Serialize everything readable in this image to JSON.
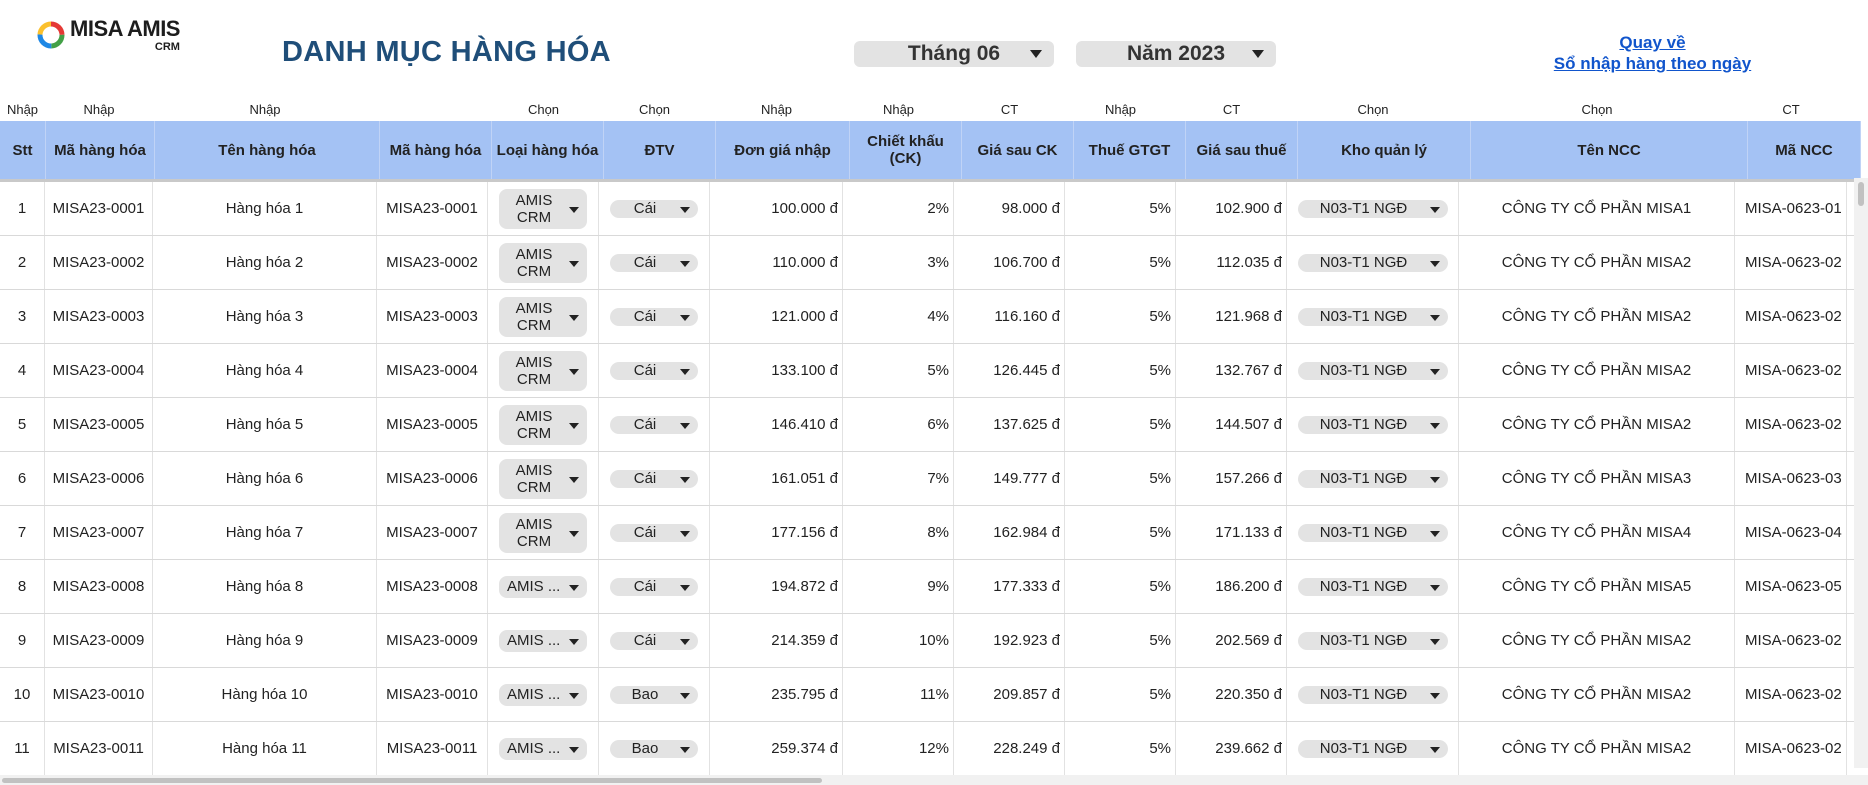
{
  "brand": {
    "name": "MISA AMIS",
    "sub": "CRM"
  },
  "title": "DANH MỤC HÀNG HÓA",
  "month_select": "Tháng 06",
  "year_select": "Năm 2023",
  "back_link": {
    "line1": "Quay về",
    "line2": "Sổ nhập hàng theo ngày"
  },
  "columns": [
    {
      "key": "stt",
      "hint": "Nhập",
      "label": "Stt"
    },
    {
      "key": "ma",
      "hint": "Nhập",
      "label": "Mã hàng hóa"
    },
    {
      "key": "ten",
      "hint": "Nhập",
      "label": "Tên hàng hóa"
    },
    {
      "key": "ma2",
      "hint": "",
      "label": "Mã hàng hóa"
    },
    {
      "key": "loai",
      "hint": "Chọn",
      "label": "Loại hàng hóa"
    },
    {
      "key": "dvt",
      "hint": "Chọn",
      "label": "ĐTV"
    },
    {
      "key": "dongia",
      "hint": "Nhập",
      "label": "Đơn giá nhập"
    },
    {
      "key": "ck",
      "hint": "Nhập",
      "label": "Chiết khấu (CK)"
    },
    {
      "key": "giack",
      "hint": "CT",
      "label": "Giá sau CK"
    },
    {
      "key": "thue",
      "hint": "Nhập",
      "label": "Thuế GTGT"
    },
    {
      "key": "giathue",
      "hint": "CT",
      "label": "Giá sau thuế"
    },
    {
      "key": "kho",
      "hint": "Chọn",
      "label": "Kho quản lý"
    },
    {
      "key": "ncc",
      "hint": "Chọn",
      "label": "Tên NCC"
    },
    {
      "key": "mancc",
      "hint": "CT",
      "label": "Mã NCC"
    }
  ],
  "rows": [
    {
      "stt": "1",
      "ma": "MISA23-0001",
      "ten": "Hàng hóa 1",
      "ma2": "MISA23-0001",
      "loai": "AMIS CRM",
      "dvt": "Cái",
      "dongia": "100.000 đ",
      "ck": "2%",
      "giack": "98.000 đ",
      "thue": "5%",
      "giathue": "102.900 đ",
      "kho": "N03-T1 NGĐ",
      "ncc": "CÔNG TY CỔ PHẦN MISA1",
      "mancc": "MISA-0623-01"
    },
    {
      "stt": "2",
      "ma": "MISA23-0002",
      "ten": "Hàng hóa 2",
      "ma2": "MISA23-0002",
      "loai": "AMIS CRM",
      "dvt": "Cái",
      "dongia": "110.000 đ",
      "ck": "3%",
      "giack": "106.700 đ",
      "thue": "5%",
      "giathue": "112.035 đ",
      "kho": "N03-T1 NGĐ",
      "ncc": "CÔNG TY CỔ PHẦN MISA2",
      "mancc": "MISA-0623-02"
    },
    {
      "stt": "3",
      "ma": "MISA23-0003",
      "ten": "Hàng hóa 3",
      "ma2": "MISA23-0003",
      "loai": "AMIS CRM",
      "dvt": "Cái",
      "dongia": "121.000 đ",
      "ck": "4%",
      "giack": "116.160 đ",
      "thue": "5%",
      "giathue": "121.968 đ",
      "kho": "N03-T1 NGĐ",
      "ncc": "CÔNG TY CỔ PHẦN MISA2",
      "mancc": "MISA-0623-02"
    },
    {
      "stt": "4",
      "ma": "MISA23-0004",
      "ten": "Hàng hóa 4",
      "ma2": "MISA23-0004",
      "loai": "AMIS CRM",
      "dvt": "Cái",
      "dongia": "133.100 đ",
      "ck": "5%",
      "giack": "126.445 đ",
      "thue": "5%",
      "giathue": "132.767 đ",
      "kho": "N03-T1 NGĐ",
      "ncc": "CÔNG TY CỔ PHẦN MISA2",
      "mancc": "MISA-0623-02"
    },
    {
      "stt": "5",
      "ma": "MISA23-0005",
      "ten": "Hàng hóa 5",
      "ma2": "MISA23-0005",
      "loai": "AMIS CRM",
      "dvt": "Cái",
      "dongia": "146.410 đ",
      "ck": "6%",
      "giack": "137.625 đ",
      "thue": "5%",
      "giathue": "144.507 đ",
      "kho": "N03-T1 NGĐ",
      "ncc": "CÔNG TY CỔ PHẦN MISA2",
      "mancc": "MISA-0623-02"
    },
    {
      "stt": "6",
      "ma": "MISA23-0006",
      "ten": "Hàng hóa 6",
      "ma2": "MISA23-0006",
      "loai": "AMIS CRM",
      "dvt": "Cái",
      "dongia": "161.051 đ",
      "ck": "7%",
      "giack": "149.777 đ",
      "thue": "5%",
      "giathue": "157.266 đ",
      "kho": "N03-T1 NGĐ",
      "ncc": "CÔNG TY CỔ PHẦN MISA3",
      "mancc": "MISA-0623-03"
    },
    {
      "stt": "7",
      "ma": "MISA23-0007",
      "ten": "Hàng hóa 7",
      "ma2": "MISA23-0007",
      "loai": "AMIS CRM",
      "dvt": "Cái",
      "dongia": "177.156 đ",
      "ck": "8%",
      "giack": "162.984 đ",
      "thue": "5%",
      "giathue": "171.133 đ",
      "kho": "N03-T1 NGĐ",
      "ncc": "CÔNG TY CỔ PHẦN MISA4",
      "mancc": "MISA-0623-04"
    },
    {
      "stt": "8",
      "ma": "MISA23-0008",
      "ten": "Hàng hóa 8",
      "ma2": "MISA23-0008",
      "loai": "AMIS ...",
      "dvt": "Cái",
      "dongia": "194.872 đ",
      "ck": "9%",
      "giack": "177.333 đ",
      "thue": "5%",
      "giathue": "186.200 đ",
      "kho": "N03-T1 NGĐ",
      "ncc": "CÔNG TY CỔ PHẦN MISA5",
      "mancc": "MISA-0623-05"
    },
    {
      "stt": "9",
      "ma": "MISA23-0009",
      "ten": "Hàng hóa 9",
      "ma2": "MISA23-0009",
      "loai": "AMIS ...",
      "dvt": "Cái",
      "dongia": "214.359 đ",
      "ck": "10%",
      "giack": "192.923 đ",
      "thue": "5%",
      "giathue": "202.569 đ",
      "kho": "N03-T1 NGĐ",
      "ncc": "CÔNG TY CỔ PHẦN MISA2",
      "mancc": "MISA-0623-02"
    },
    {
      "stt": "10",
      "ma": "MISA23-0010",
      "ten": "Hàng hóa 10",
      "ma2": "MISA23-0010",
      "loai": "AMIS ...",
      "dvt": "Bao",
      "dongia": "235.795 đ",
      "ck": "11%",
      "giack": "209.857 đ",
      "thue": "5%",
      "giathue": "220.350 đ",
      "kho": "N03-T1 NGĐ",
      "ncc": "CÔNG TY CỔ PHẦN MISA2",
      "mancc": "MISA-0623-02"
    },
    {
      "stt": "11",
      "ma": "MISA23-0011",
      "ten": "Hàng hóa 11",
      "ma2": "MISA23-0011",
      "loai": "AMIS ...",
      "dvt": "Bao",
      "dongia": "259.374 đ",
      "ck": "12%",
      "giack": "228.249 đ",
      "thue": "5%",
      "giathue": "239.662 đ",
      "kho": "N03-T1 NGĐ",
      "ncc": "CÔNG TY CỔ PHẦN MISA2",
      "mancc": "MISA-0623-02"
    }
  ]
}
